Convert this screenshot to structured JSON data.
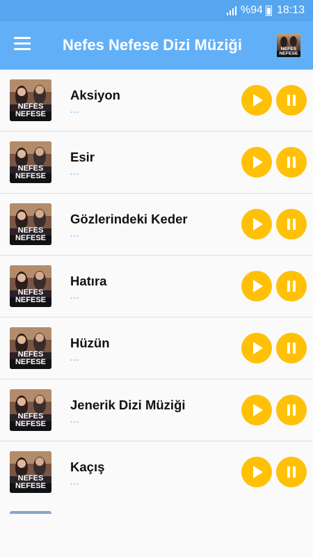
{
  "status": {
    "battery": "%94",
    "time": "18:13",
    "icons": [
      "signal-icon",
      "battery-icon"
    ]
  },
  "app_bar": {
    "title": "Nefes Nefese Dizi Müziği",
    "menu_icon": "hamburger-menu-icon",
    "avatar_icon": "show-poster-icon",
    "color": "#61b0f7"
  },
  "poster_text": [
    "NEFES",
    "NEFESE"
  ],
  "songs": [
    {
      "title": "Aksiyon",
      "subtitle": "---"
    },
    {
      "title": "Esir",
      "subtitle": "---"
    },
    {
      "title": "Gözlerindeki Keder",
      "subtitle": "---"
    },
    {
      "title": "Hatıra",
      "subtitle": "---"
    },
    {
      "title": "Hüzün",
      "subtitle": "---"
    },
    {
      "title": "Jenerik Dizi Müziği",
      "subtitle": "---"
    },
    {
      "title": "Kaçış",
      "subtitle": "---"
    }
  ],
  "buttons": {
    "play_icon": "play-icon",
    "pause_icon": "pause-icon",
    "color": "#ffc107"
  }
}
